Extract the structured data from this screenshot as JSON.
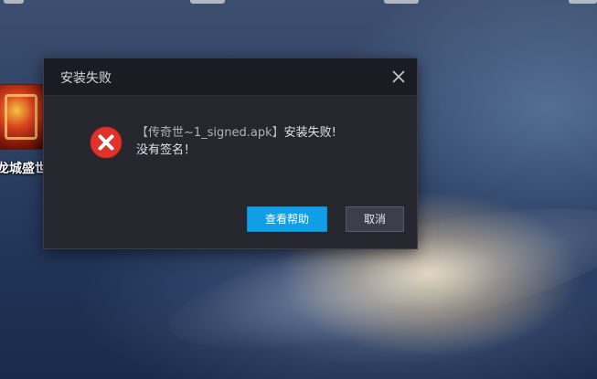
{
  "desktop": {
    "icon_label": "龙城盛世",
    "top_label_count_hint": "partially visible desktop labels at top edge"
  },
  "dialog": {
    "title": "安装失败",
    "close_icon": "close-icon",
    "error_icon": "error-x-icon",
    "message": {
      "file_name": "【传奇世~1_signed.apk】",
      "status": "安装失败!",
      "reason": "没有签名！"
    },
    "buttons": {
      "help": "查看帮助",
      "cancel": "取消"
    }
  },
  "colors": {
    "dialog_bg": "#25262e",
    "titlebar_bg": "#1b1c23",
    "primary_button": "#109fe6",
    "secondary_button": "#3c3f4b",
    "error_red": "#e0322a"
  }
}
